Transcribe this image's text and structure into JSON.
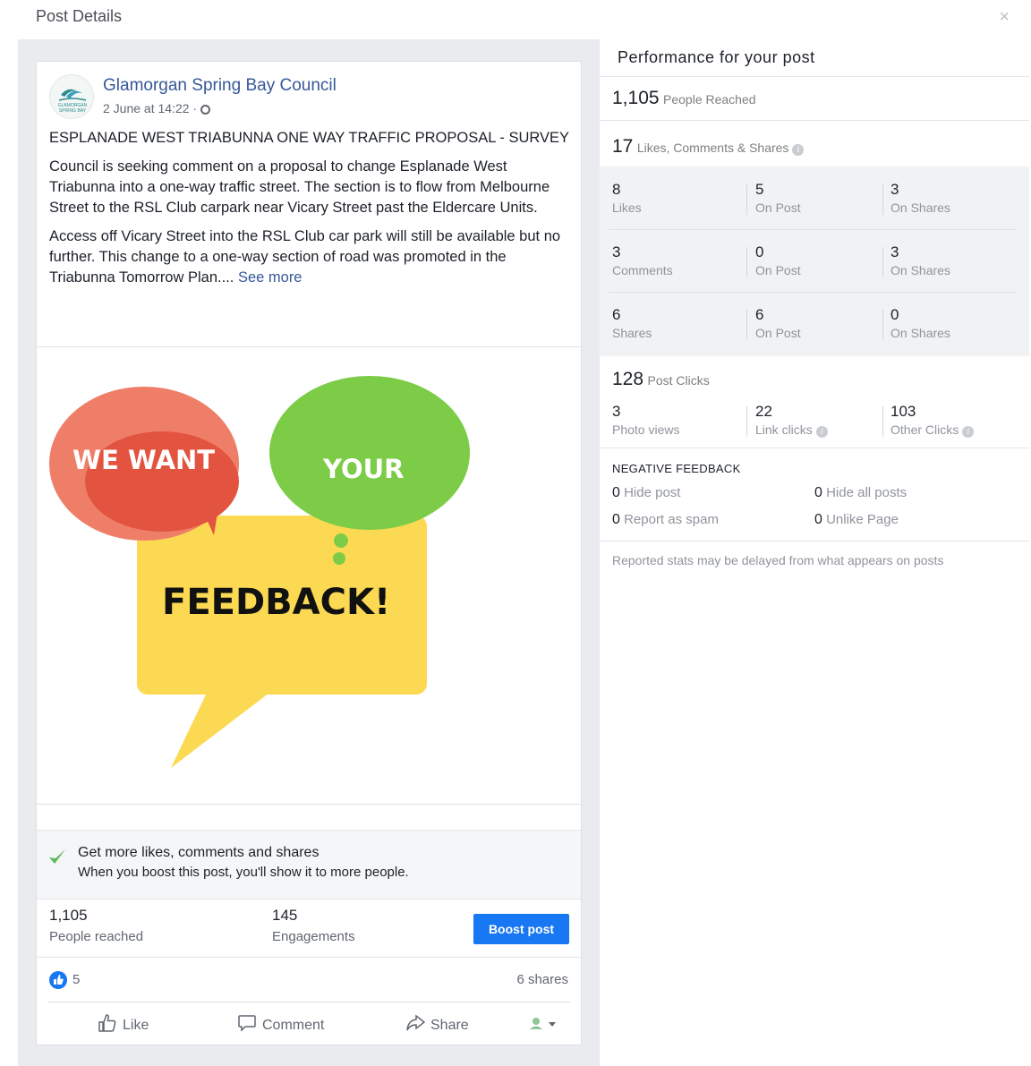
{
  "dialog": {
    "title": "Post Details",
    "close": "×"
  },
  "post": {
    "page_name": "Glamorgan Spring Bay Council",
    "date": "2 June at 14:22 ·",
    "heading": "ESPLANADE WEST TRIABUNNA ONE WAY TRAFFIC PROPOSAL - SURVEY",
    "para1": "Council is seeking comment on a proposal to change Esplanade West Triabunna into a one-way traffic street. The section is to flow from Melbourne Street to the RSL Club carpark near Vicary Street past the Eldercare Units.",
    "para2": "Access off Vicary Street into the RSL Club car park will still be available but no further. This change to a one-way section of road was promoted in the Triabunna Tomorrow Plan....",
    "see_more": "See more",
    "avatar_text": "GLAMORGAN SPRING BAY",
    "image": {
      "line1": "WE WANT",
      "line2": "YOUR",
      "line3": "FEEDBACK!"
    }
  },
  "boost": {
    "title": "Get more likes, comments and shares",
    "subtitle": "When you boost this post, you'll show it to more people.",
    "button": "Boost post"
  },
  "summary": {
    "reached_value": "1,105",
    "reached_label": "People reached",
    "engagements_value": "145",
    "engagements_label": "Engagements"
  },
  "reactions": {
    "count": "5",
    "shares": "6 shares"
  },
  "actions": {
    "like": "Like",
    "comment": "Comment",
    "share": "Share"
  },
  "performance": {
    "title": "Performance for your post",
    "people_reached_value": "1,105",
    "people_reached_label": "People Reached",
    "engagement_value": "17",
    "engagement_label": "Likes, Comments & Shares",
    "grid": [
      [
        {
          "n": "8",
          "l": "Likes"
        },
        {
          "n": "5",
          "l": "On Post"
        },
        {
          "n": "3",
          "l": "On Shares"
        }
      ],
      [
        {
          "n": "3",
          "l": "Comments"
        },
        {
          "n": "0",
          "l": "On Post"
        },
        {
          "n": "3",
          "l": "On Shares"
        }
      ],
      [
        {
          "n": "6",
          "l": "Shares"
        },
        {
          "n": "6",
          "l": "On Post"
        },
        {
          "n": "0",
          "l": "On Shares"
        }
      ]
    ],
    "post_clicks_value": "128",
    "post_clicks_label": "Post Clicks",
    "clicks": [
      {
        "n": "3",
        "l": "Photo views"
      },
      {
        "n": "22",
        "l": "Link clicks"
      },
      {
        "n": "103",
        "l": "Other Clicks"
      }
    ],
    "negative_title": "NEGATIVE FEEDBACK",
    "negative": [
      {
        "n": "0",
        "l": "Hide post"
      },
      {
        "n": "0",
        "l": "Hide all posts"
      },
      {
        "n": "0",
        "l": "Report as spam"
      },
      {
        "n": "0",
        "l": "Unlike Page"
      }
    ],
    "disclaimer": "Reported stats may be delayed from what appears on posts"
  },
  "colors": {
    "brand_blue": "#1877f2",
    "link_blue": "#365899",
    "bubble_red": "#e2543f",
    "bubble_green": "#7dcc47",
    "bubble_yellow": "#fcd953"
  }
}
